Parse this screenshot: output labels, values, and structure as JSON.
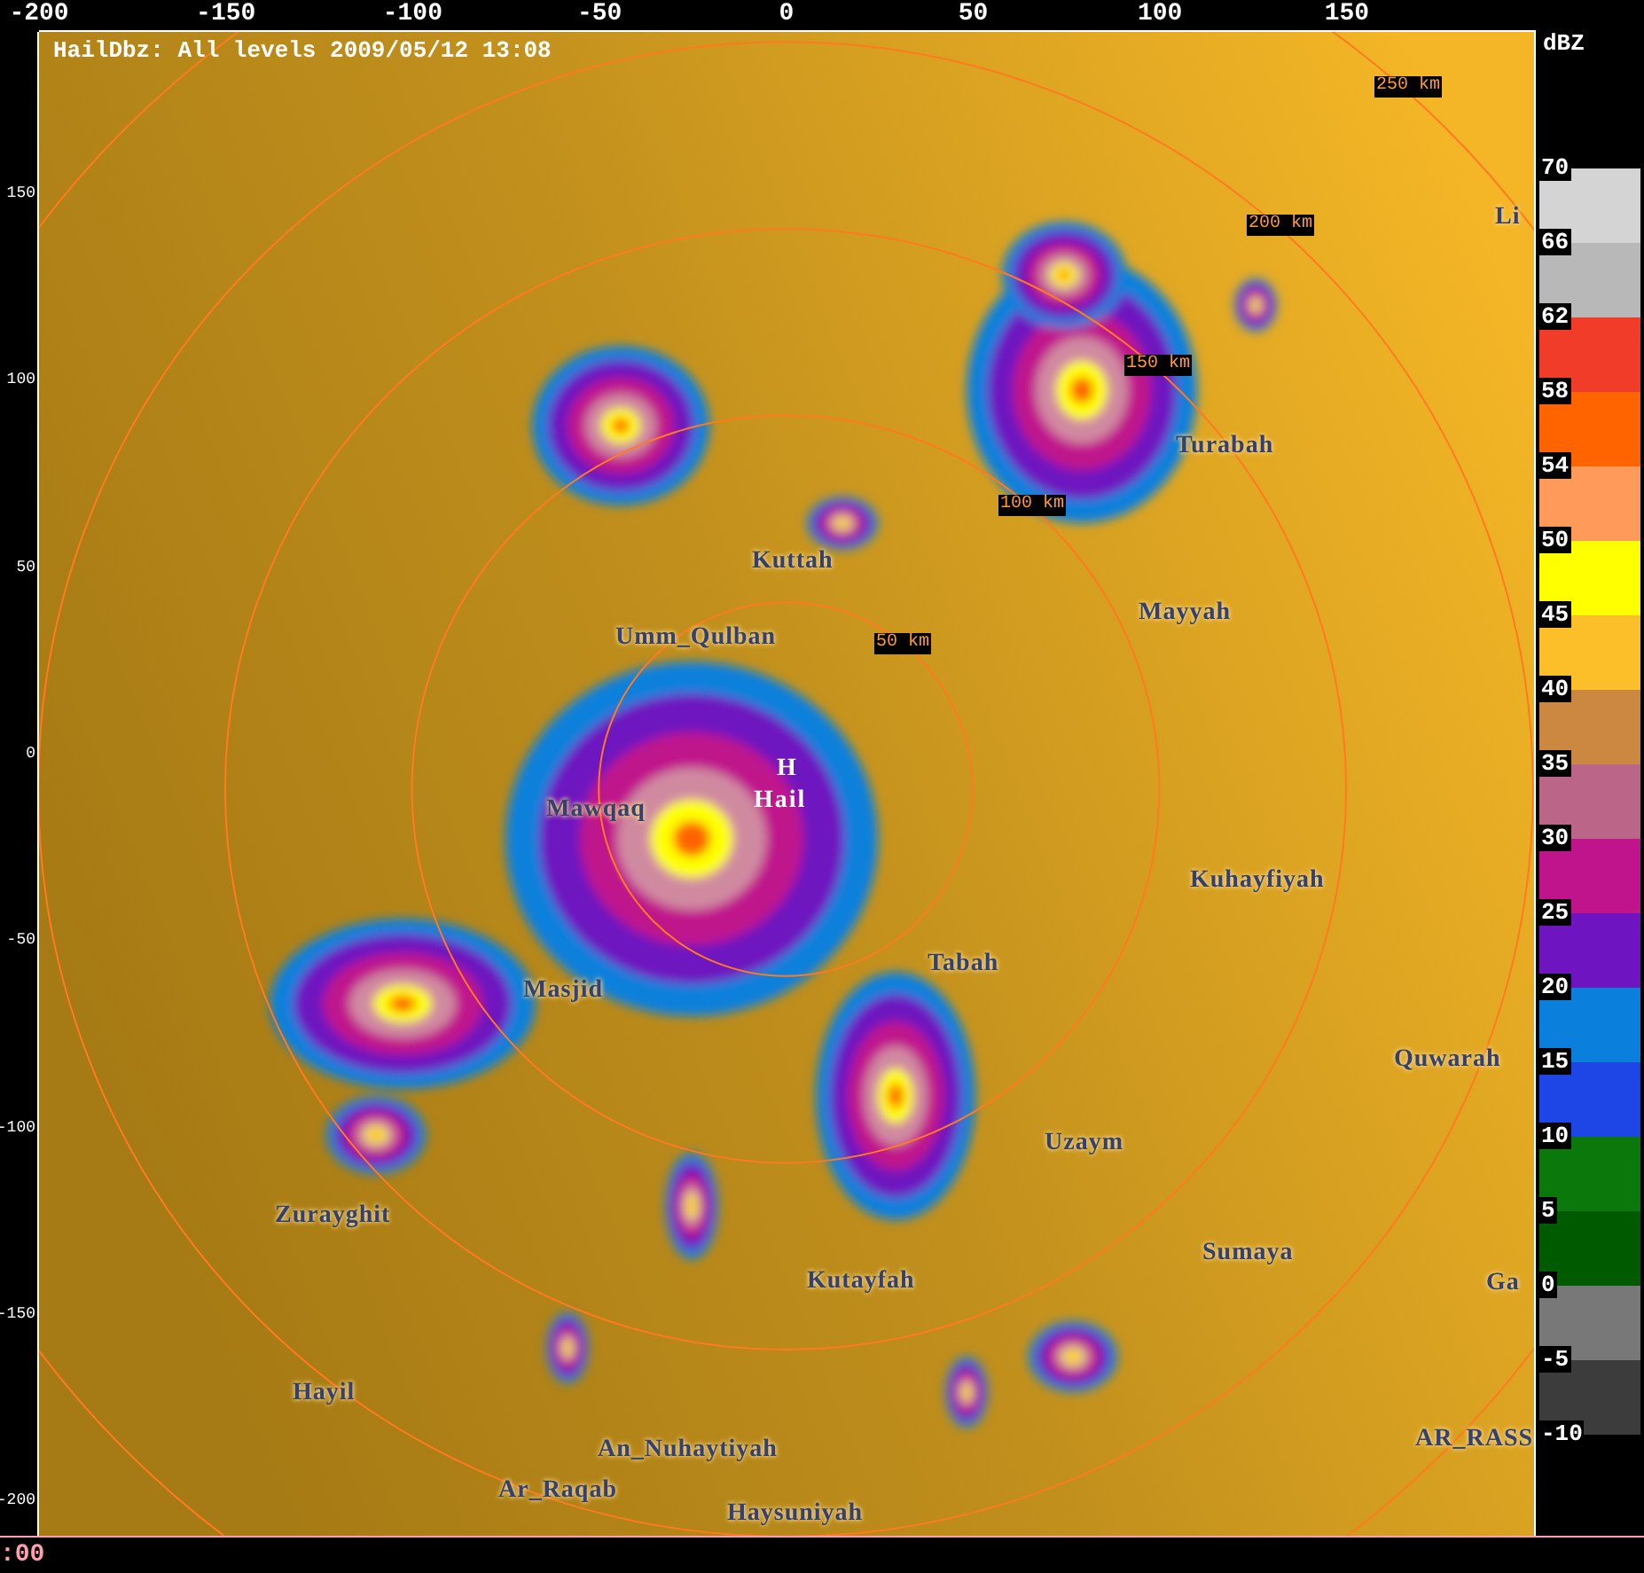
{
  "title": "HailDbz: All levels 2009/05/12 13:08",
  "x_axis": [
    "-200",
    "-150",
    "-100",
    "-50",
    "0",
    "50",
    "100",
    "150"
  ],
  "y_axis": [
    "150",
    "100",
    "50",
    "0",
    "-50",
    "-100",
    "-150",
    "-200"
  ],
  "range_labels": [
    "50 km",
    "100 km",
    "150 km",
    "200 km",
    "250 km"
  ],
  "radar_site": {
    "marker": "H",
    "name": "Hail"
  },
  "places": [
    "Li",
    "Turabah",
    "Kuttah",
    "Umm_Qulban",
    "Mayyah",
    "Mawqaq",
    "Kuhayfiyah",
    "Tabah",
    "Masjid",
    "Quwarah",
    "Uzaym",
    "Zurayghit",
    "Kutayfah",
    "Sumaya",
    "Ga",
    "Hayil",
    "AR_RASS",
    "An_Nuhaytiyah",
    "Ar_Raqab",
    "Haysuniyah"
  ],
  "legend": {
    "unit": "dBZ",
    "bands": [
      {
        "label": "70",
        "color": "#d4d4d4"
      },
      {
        "label": "66",
        "color": "#b8b8b8"
      },
      {
        "label": "62",
        "color": "#f03c28"
      },
      {
        "label": "58",
        "color": "#ff6400"
      },
      {
        "label": "54",
        "color": "#ff9a5a"
      },
      {
        "label": "50",
        "color": "#ffff00"
      },
      {
        "label": "45",
        "color": "#fcbf2a"
      },
      {
        "label": "40",
        "color": "#cc8840"
      },
      {
        "label": "35",
        "color": "#bb6688"
      },
      {
        "label": "30",
        "color": "#c0148c"
      },
      {
        "label": "25",
        "color": "#6e14c0"
      },
      {
        "label": "20",
        "color": "#0a80dc"
      },
      {
        "label": "15",
        "color": "#1e46e6"
      },
      {
        "label": "10",
        "color": "#0a780a"
      },
      {
        "label": "5",
        "color": "#005a00"
      },
      {
        "label": "0",
        "color": "#787878"
      },
      {
        "label": "-5",
        "color": "#3c3c3c"
      }
    ],
    "bottom_label": "-10"
  },
  "status": ":00"
}
